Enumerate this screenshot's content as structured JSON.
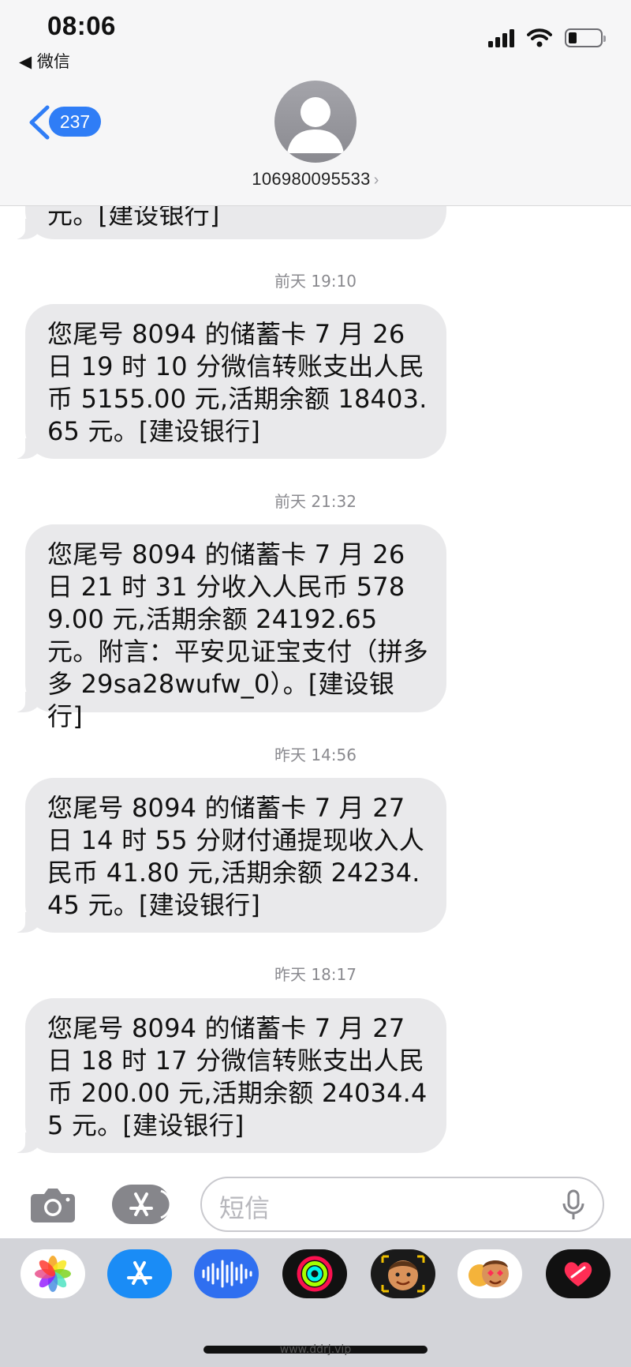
{
  "status_bar": {
    "time": "08:06",
    "back_app": "◀ 微信"
  },
  "header": {
    "unread_count": "237",
    "contact": "106980095533",
    "contact_chevron": "›"
  },
  "messages": [
    {
      "partial": true,
      "text": "元。[建设银行]"
    },
    {
      "timestamp": "前天 19:10",
      "text": "您尾号 8094 的储蓄卡 7 月 26 日 19 时 10 分微信转账支出人民币 5155.00 元,活期余额 18403.65 元。[建设银行]"
    },
    {
      "timestamp": "前天 21:32",
      "text": "您尾号 8094 的储蓄卡 7 月 26 日 21 时 31 分收入人民币 5789.00 元,活期余额 24192.65 元。附言：平安见证宝支付（拼多多 29sa28wufw_0）。[建设银行]"
    },
    {
      "timestamp": "昨天 14:56",
      "text": "您尾号 8094 的储蓄卡 7 月 27 日 14 时 55 分财付通提现收入人民币 41.80 元,活期余额 24234.45 元。[建设银行]"
    },
    {
      "timestamp": "昨天 18:17",
      "text": "您尾号 8094 的储蓄卡 7 月 27 日 18 时 17 分微信转账支出人民币 200.00 元,活期余额 24034.45 元。[建设银行]"
    }
  ],
  "input": {
    "placeholder": "短信"
  },
  "tray": {
    "apps": [
      "photos-icon",
      "app-store-icon",
      "audio-icon",
      "fitness-icon",
      "memoji-icon",
      "memoji-stickers-icon",
      "digital-touch-icon"
    ]
  },
  "watermark": "www.ddrj.vip"
}
